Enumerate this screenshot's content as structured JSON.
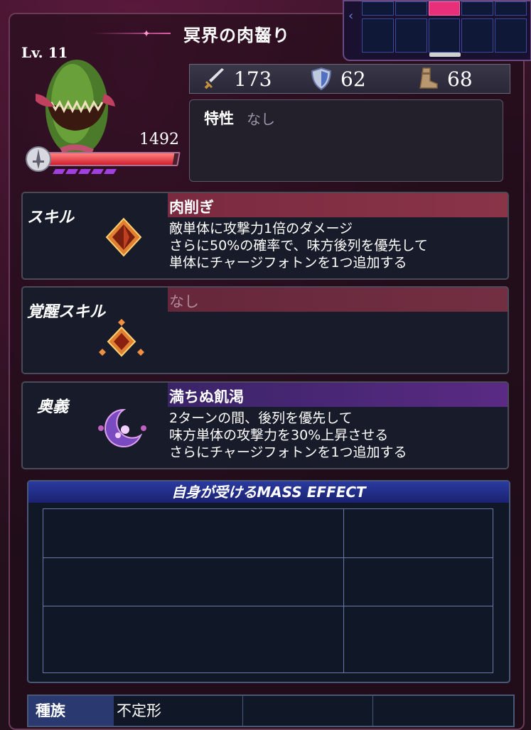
{
  "monster": {
    "name": "冥界の肉齧り",
    "level": "Lv. 11",
    "hp": "1492",
    "hp_fill": 0.97,
    "gem_count": 5
  },
  "stats": {
    "attack": "173",
    "defense": "62",
    "speed": "68"
  },
  "trait": {
    "label": "特性",
    "value": "なし"
  },
  "skill": {
    "label": "スキル",
    "name": "肉削ぎ",
    "lines": [
      "敵単体に攻撃力1倍のダメージ",
      "さらに50%の確率で、味方後列を優先して",
      "単体にチャージフォトンを1つ追加する"
    ]
  },
  "awaken_skill": {
    "label": "覚醒スキル",
    "name": "なし"
  },
  "ougi": {
    "label": "奥義",
    "name": "満ちぬ飢渇",
    "lines": [
      "2ターンの間、後列を優先して",
      "味方単体の攻撃力を30%上昇させる",
      "さらにチャージフォトンを1つ追加する"
    ]
  },
  "mass_effect": {
    "header": "自身が受けるMASS EFFECT"
  },
  "race": {
    "label": "種族",
    "value": "不定形"
  },
  "colors": {
    "skill_bar": "#8a3448",
    "ougi_bar": "#5a2a84",
    "mass_header": "#2a3aa0"
  }
}
